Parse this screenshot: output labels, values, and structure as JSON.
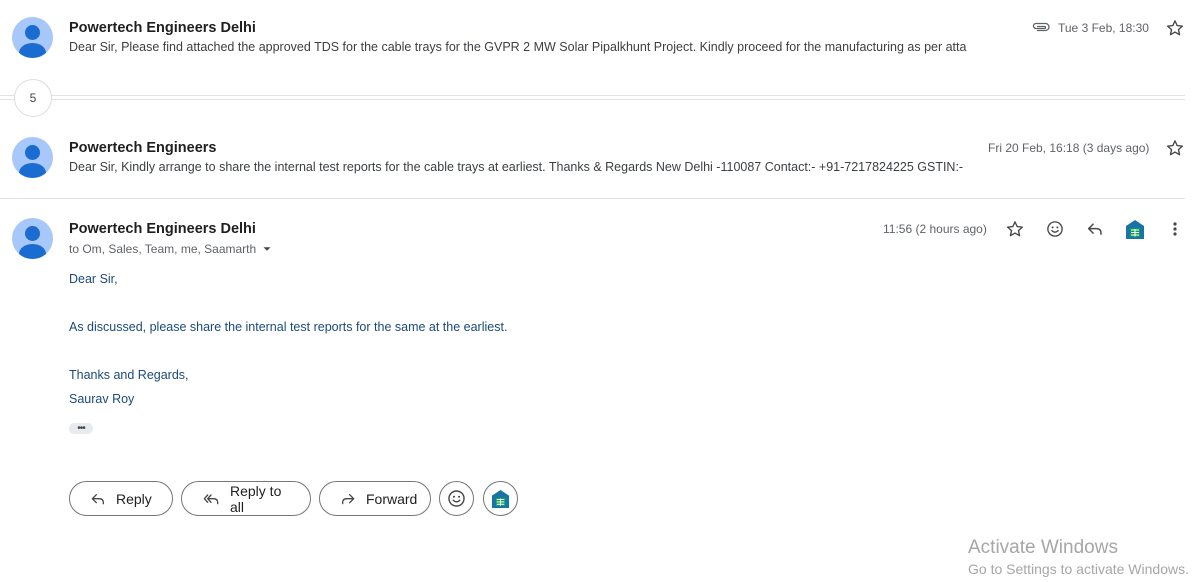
{
  "thread": {
    "collapsed_count": "5",
    "messages": [
      {
        "sender": "Powertech Engineers Delhi",
        "snippet": "Dear Sir, Please find attached the approved TDS for the cable trays for the GVPR 2 MW Solar Pipalkhunt Project. Kindly proceed for the manufacturing as per atta",
        "date": "Tue 3 Feb, 18:30",
        "has_attachment": true
      },
      {
        "sender": "Powertech Engineers",
        "snippet": "Dear Sir, Kindly arrange to share the internal test reports for the cable trays at earliest. Thanks & Regards New Delhi -110087 Contact:- +91-7217824225 GSTIN:-",
        "date": "Fri 20 Feb, 16:18 (3 days ago)"
      }
    ],
    "open_message": {
      "sender": "Powertech Engineers Delhi",
      "date": "11:56 (2 hours ago)",
      "recipients": "to Om, Sales, Team, me, Saamarth",
      "body": {
        "greeting": "Dear Sir,",
        "paragraph": "As discussed, please share the internal test reports for the same at the earliest.",
        "closing": "Thanks and Regards,",
        "signature": "Saurav Roy"
      },
      "trimmed_content": "•••"
    }
  },
  "actions": {
    "reply": "Reply",
    "reply_all": "Reply to all",
    "forward": "Forward"
  },
  "watermark": {
    "title": "Activate Windows",
    "subtitle": "Go to Settings to activate Windows."
  },
  "colors": {
    "avatar_bg": "#a8c7fa",
    "avatar_fg": "#1a6cd0",
    "body_text": "#1c4a7a",
    "sheets_green": "#0f9d58"
  },
  "icons": [
    "attachment-icon",
    "star-icon",
    "emoji-icon",
    "reply-icon",
    "sheets-icon",
    "more-icon",
    "reply-all-icon",
    "forward-icon",
    "chevron-down-icon"
  ]
}
